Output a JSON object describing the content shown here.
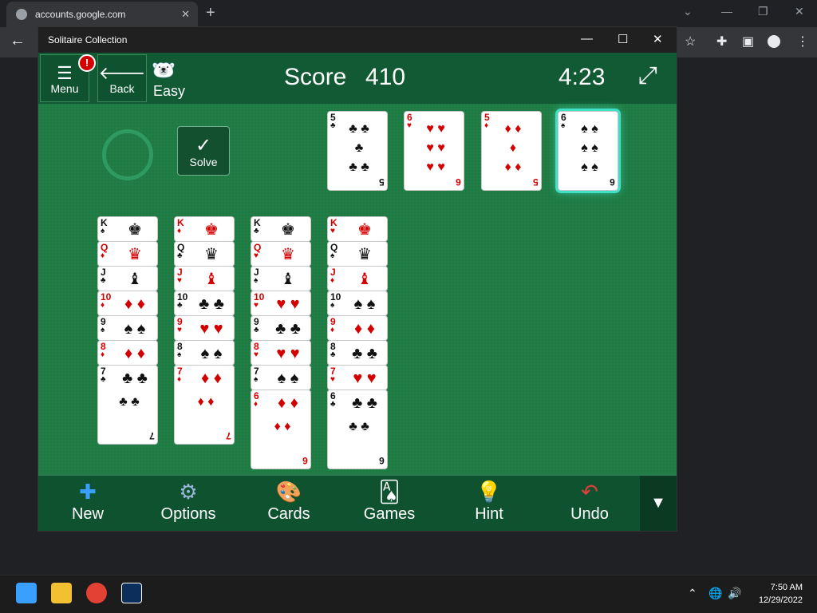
{
  "browser": {
    "tab_title": "accounts.google.com",
    "new_tab": "+",
    "close": "✕"
  },
  "app": {
    "title": "Solitaire Collection",
    "menu_label": "Menu",
    "back_label": "Back",
    "difficulty": "Easy",
    "score_label": "Score",
    "score_value": "410",
    "timer": "4:23",
    "solve_label": "Solve",
    "foundation": [
      {
        "rank": "5",
        "suit": "♣",
        "color": "black",
        "pips": [
          "♣ ♣",
          "♣",
          "♣ ♣"
        ]
      },
      {
        "rank": "6",
        "suit": "♥",
        "color": "red",
        "pips": [
          "♥ ♥",
          "♥ ♥",
          "♥ ♥"
        ]
      },
      {
        "rank": "5",
        "suit": "♦",
        "color": "red",
        "pips": [
          "♦ ♦",
          "♦",
          "♦ ♦"
        ]
      },
      {
        "rank": "6",
        "suit": "♠",
        "color": "black",
        "pips": [
          "♠ ♠",
          "♠ ♠",
          "♠ ♠"
        ]
      }
    ],
    "tableau": [
      [
        {
          "r": "K",
          "s": "♠"
        },
        {
          "r": "Q",
          "s": "♦"
        },
        {
          "r": "J",
          "s": "♣"
        },
        {
          "r": "10",
          "s": "♦"
        },
        {
          "r": "9",
          "s": "♠"
        },
        {
          "r": "8",
          "s": "♦"
        },
        {
          "r": "7",
          "s": "♣"
        }
      ],
      [
        {
          "r": "K",
          "s": "♦"
        },
        {
          "r": "Q",
          "s": "♣"
        },
        {
          "r": "J",
          "s": "♥"
        },
        {
          "r": "10",
          "s": "♣"
        },
        {
          "r": "9",
          "s": "♥"
        },
        {
          "r": "8",
          "s": "♠"
        },
        {
          "r": "7",
          "s": "♦"
        }
      ],
      [
        {
          "r": "K",
          "s": "♣"
        },
        {
          "r": "Q",
          "s": "♥"
        },
        {
          "r": "J",
          "s": "♠"
        },
        {
          "r": "10",
          "s": "♥"
        },
        {
          "r": "9",
          "s": "♣"
        },
        {
          "r": "8",
          "s": "♥"
        },
        {
          "r": "7",
          "s": "♠"
        },
        {
          "r": "6",
          "s": "♦"
        }
      ],
      [
        {
          "r": "K",
          "s": "♥"
        },
        {
          "r": "Q",
          "s": "♠"
        },
        {
          "r": "J",
          "s": "♦"
        },
        {
          "r": "10",
          "s": "♠"
        },
        {
          "r": "9",
          "s": "♦"
        },
        {
          "r": "8",
          "s": "♣"
        },
        {
          "r": "7",
          "s": "♥"
        },
        {
          "r": "6",
          "s": "♣"
        }
      ]
    ],
    "bottom": {
      "new": "New",
      "options": "Options",
      "cards": "Cards",
      "games": "Games",
      "hint": "Hint",
      "undo": "Undo"
    }
  },
  "taskbar": {
    "time": "7:50 AM",
    "date": "12/29/2022"
  }
}
